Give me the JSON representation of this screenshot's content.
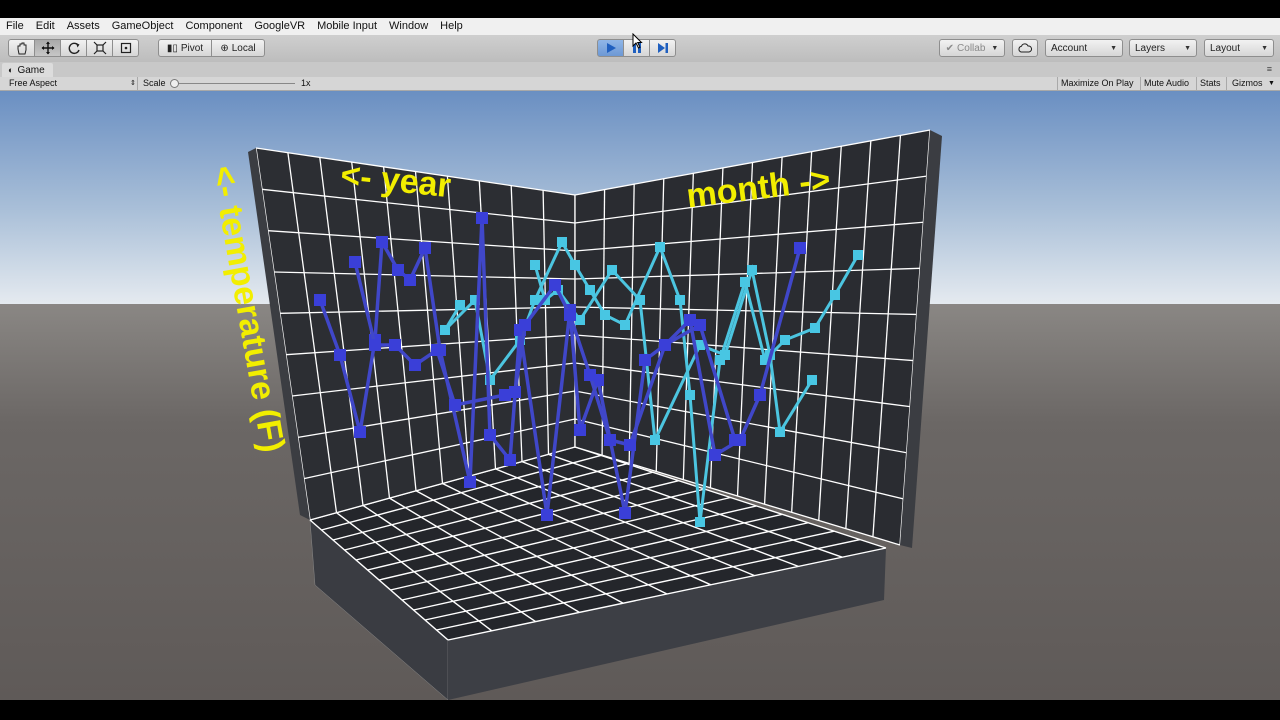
{
  "menu": {
    "items": [
      "File",
      "Edit",
      "Assets",
      "GameObject",
      "Component",
      "GoogleVR",
      "Mobile Input",
      "Window",
      "Help"
    ]
  },
  "toolbar": {
    "tools": [
      "hand-tool",
      "move-tool",
      "rotate-tool",
      "scale-tool",
      "rect-tool"
    ],
    "active_tool": "move-tool",
    "pivot_label": "Pivot",
    "local_label": "Local",
    "play_icons": [
      "play-icon",
      "pause-icon",
      "step-icon"
    ],
    "collab_label": "Collab",
    "account_label": "Account",
    "layers_label": "Layers",
    "layout_label": "Layout"
  },
  "game_tab": {
    "title": "Game"
  },
  "game_bar": {
    "aspect": "Free Aspect",
    "scale_label": "Scale",
    "scale_value": "1x",
    "maximize_label": "Maximize On Play",
    "mute_label": "Mute Audio",
    "stats_label": "Stats",
    "gizmos_label": "Gizmos"
  },
  "scene": {
    "label_year": "<- year",
    "label_month": "month ->",
    "label_temperature": "<- temperature (F)",
    "colors": {
      "sky_top": "#6f93c4",
      "horizon": "#dfe6ee",
      "ground": "#6a6664",
      "panel": "#2b2d32",
      "grid": "#ffffff",
      "label": "#f2ee00",
      "series_dark": "#3a3fd8",
      "series_light": "#48c6e3"
    }
  }
}
